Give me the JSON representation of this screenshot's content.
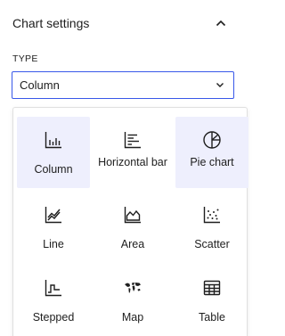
{
  "panel": {
    "title": "Chart settings",
    "collapse_icon": "chevron-up-icon"
  },
  "type_field": {
    "label": "TYPE",
    "selected_value": "Column",
    "caret_icon": "chevron-down-icon"
  },
  "accent_color": "#3858e9",
  "selected_tile_color": "#eeeffd",
  "options": [
    {
      "label": "Column",
      "icon": "column-chart-icon",
      "selected": true
    },
    {
      "label": "Horizontal bar",
      "icon": "horizontal-bar-chart-icon",
      "selected": false
    },
    {
      "label": "Pie chart",
      "icon": "pie-chart-icon",
      "selected": true
    },
    {
      "label": "Line",
      "icon": "line-chart-icon",
      "selected": false
    },
    {
      "label": "Area",
      "icon": "area-chart-icon",
      "selected": false
    },
    {
      "label": "Scatter",
      "icon": "scatter-chart-icon",
      "selected": false
    },
    {
      "label": "Stepped",
      "icon": "stepped-chart-icon",
      "selected": false
    },
    {
      "label": "Map",
      "icon": "map-chart-icon",
      "selected": false
    },
    {
      "label": "Table",
      "icon": "table-icon",
      "selected": false
    }
  ]
}
